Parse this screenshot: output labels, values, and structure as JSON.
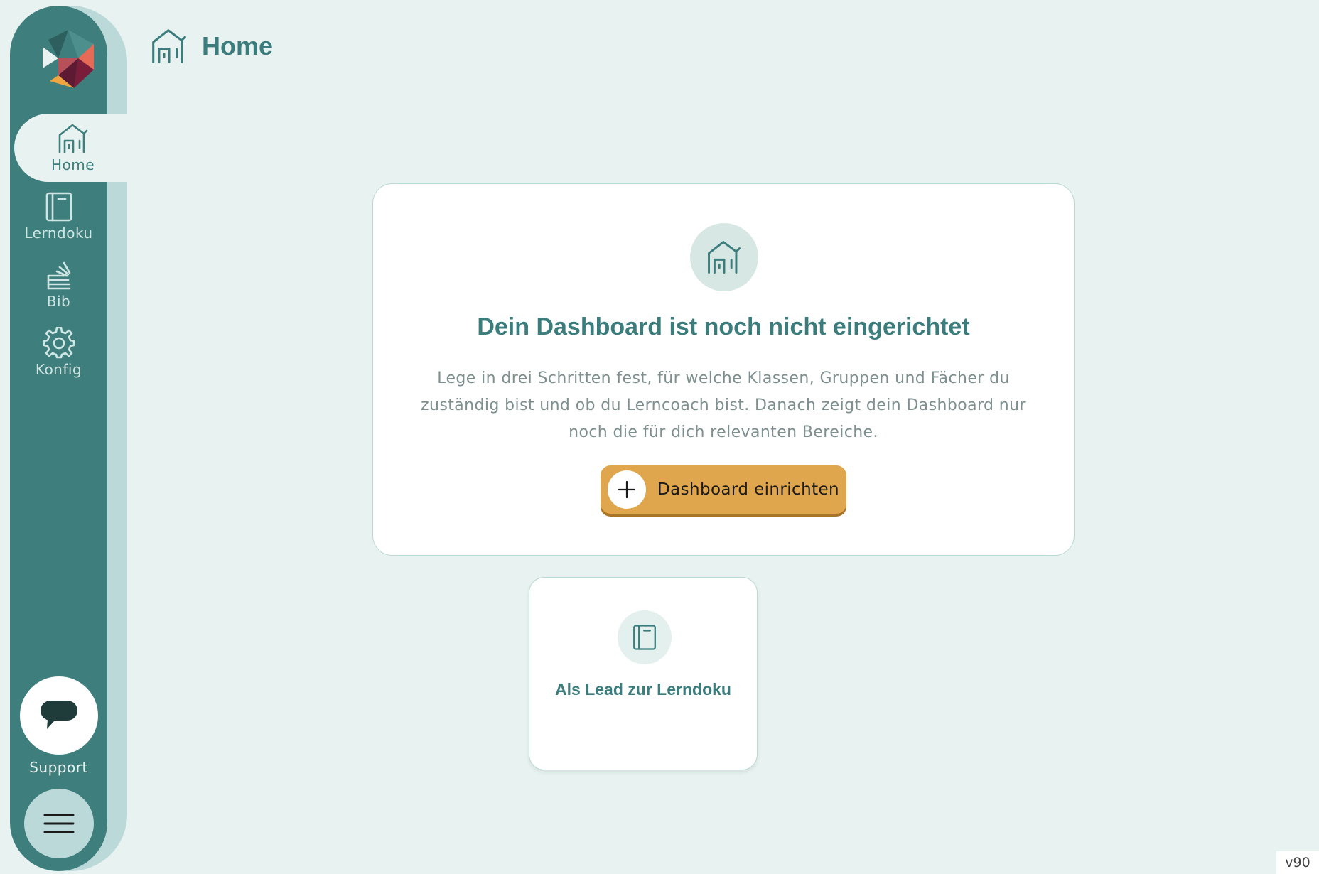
{
  "sidebar": {
    "items": [
      {
        "label": "Home",
        "icon": "house-icon",
        "active": true
      },
      {
        "label": "Lerndoku",
        "icon": "notebook-icon",
        "active": false
      },
      {
        "label": "Bib",
        "icon": "books-icon",
        "active": false
      },
      {
        "label": "Konfig",
        "icon": "gear-icon",
        "active": false
      }
    ],
    "support_label": "Support",
    "menu_icon": "hamburger-icon"
  },
  "header": {
    "title": "Home",
    "icon": "house-icon"
  },
  "setup_card": {
    "title": "Dein Dashboard ist noch nicht eingerichtet",
    "description": "Lege in drei Schritten fest, für welche Klassen, Gruppen und Fächer du zuständig bist und ob du Lerncoach bist. Danach zeigt dein Dashboard nur noch die für dich relevanten Bereiche.",
    "button_label": "Dashboard einrichten",
    "button_icon": "plus-icon"
  },
  "lead_card": {
    "label": "Als Lead zur Lerndoku",
    "icon": "notebook-icon"
  },
  "version": "v90",
  "colors": {
    "primary": "#3e7e7c",
    "background": "#e8f2f0",
    "sidebar_shade": "#bcd9da",
    "accent": "#e0a64d"
  }
}
